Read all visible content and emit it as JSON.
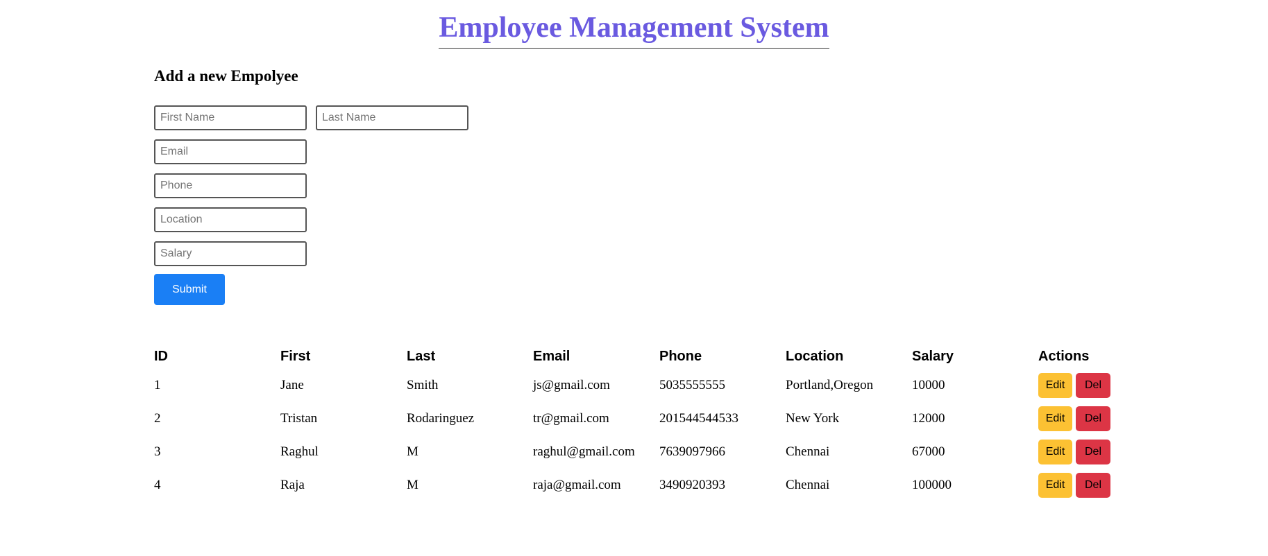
{
  "header": {
    "title": "Employee Management System"
  },
  "form": {
    "heading": "Add a new Empolyee",
    "first_name_placeholder": "First Name",
    "last_name_placeholder": "Last Name",
    "email_placeholder": "Email",
    "phone_placeholder": "Phone",
    "location_placeholder": "Location",
    "salary_placeholder": "Salary",
    "submit_label": "Submit"
  },
  "table": {
    "columns": [
      "ID",
      "First",
      "Last",
      "Email",
      "Phone",
      "Location",
      "Salary",
      "Actions"
    ],
    "edit_label": "Edit",
    "delete_label": "Del",
    "rows": [
      {
        "id": "1",
        "first": "Jane",
        "last": "Smith",
        "email": "js@gmail.com",
        "phone": "5035555555",
        "location": "Portland,Oregon",
        "salary": "10000"
      },
      {
        "id": "2",
        "first": "Tristan",
        "last": "Rodaringuez",
        "email": "tr@gmail.com",
        "phone": "201544544533",
        "location": "New York",
        "salary": "12000"
      },
      {
        "id": "3",
        "first": "Raghul",
        "last": "M",
        "email": "raghul@gmail.com",
        "phone": "7639097966",
        "location": "Chennai",
        "salary": "67000"
      },
      {
        "id": "4",
        "first": "Raja",
        "last": "M",
        "email": "raja@gmail.com",
        "phone": "3490920393",
        "location": "Chennai",
        "salary": "100000"
      }
    ]
  },
  "colors": {
    "title": "#6a5ae0",
    "submit": "#1a7ff5",
    "edit": "#fcc133",
    "delete": "#dc3545"
  }
}
